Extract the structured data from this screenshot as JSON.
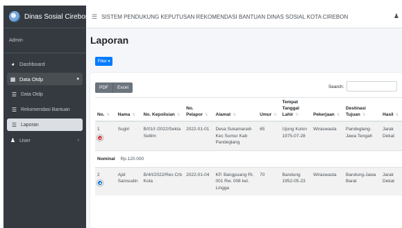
{
  "sidebar": {
    "brand": "Dinas Sosial Cirebon",
    "user": "Admin",
    "items": [
      {
        "label": "Dashboard"
      },
      {
        "label": "Data Otdp"
      },
      {
        "label": "User"
      }
    ],
    "subitems": [
      {
        "label": "Data Otdp"
      },
      {
        "label": "Rekomendasi Bantuan"
      },
      {
        "label": "Laporan"
      }
    ]
  },
  "navbar": {
    "title": "SISTEM PENDUKUNG KEPUTUSAN REKOMENDASI BANTUAN DINAS SOSIAL KOTA CIREBON"
  },
  "page": {
    "title": "Laporan",
    "filter_label": "Filter ▾",
    "pdf_label": "PDF",
    "excel_label": "Excel",
    "search_label": "Search:"
  },
  "table": {
    "headers": [
      "No.",
      "Nama",
      "No. Kepolisian",
      "No. Pelapor",
      "Alamat",
      "Umur",
      "Tempat Tanggal Lahir",
      "Pekerjaan",
      "Destinasi Tujuan",
      "Hasil"
    ],
    "rows": [
      {
        "no": "1",
        "nama": "Sugiri",
        "kepolisian": "B/01/I /2022/Sekta Seltim",
        "pelapor": "2022-01-01",
        "alamat": "Desa Sukamanah Kec Sumur Kab Pandeglang",
        "umur": "65",
        "ttl": "Ujung Kulon 1975-07-28",
        "pekerjaan": "Wiraswasta",
        "tujuan": "Pandeglang-Jawa Tengah",
        "hasil": "Jarak Dekat"
      },
      {
        "no": "2",
        "nama": "Ajid Samsudin",
        "kepolisian": "B/4/I/2022/Res Crb Kota",
        "pelapor": "2022-01-04",
        "alamat": "KP. Bangpuang Rt. 001 Rw. 008 kel. Lingga",
        "umur": "70",
        "ttl": "Bandung 1952-05-23",
        "pekerjaan": "Wiraswasta",
        "tujuan": "Bandung-Jawa Barat",
        "hasil": "Jarak Dekat"
      }
    ],
    "child_row": {
      "label": "Nominal",
      "value": "Rp.120.000"
    }
  },
  "colors": {
    "sidebar": "#343a40",
    "accent": "#007bff",
    "expand_open": "#d33333",
    "expand_closed": "#0275d8"
  }
}
